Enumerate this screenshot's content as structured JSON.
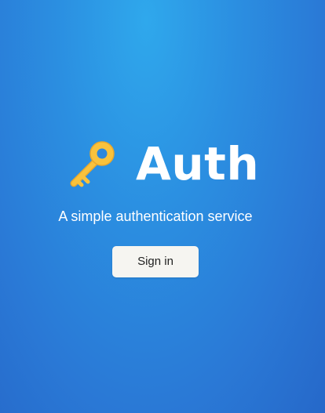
{
  "hero": {
    "icon": "key-icon",
    "title": "Auth",
    "tagline": "A simple authentication service"
  },
  "actions": {
    "signin_label": "Sign in"
  },
  "colors": {
    "background_top": "#2fa8ec",
    "background_bottom": "#2668c9",
    "key_gold": "#f9c23c",
    "key_shadow": "#e9a82d",
    "button_bg": "#f6f5f1",
    "text": "#ffffff"
  }
}
